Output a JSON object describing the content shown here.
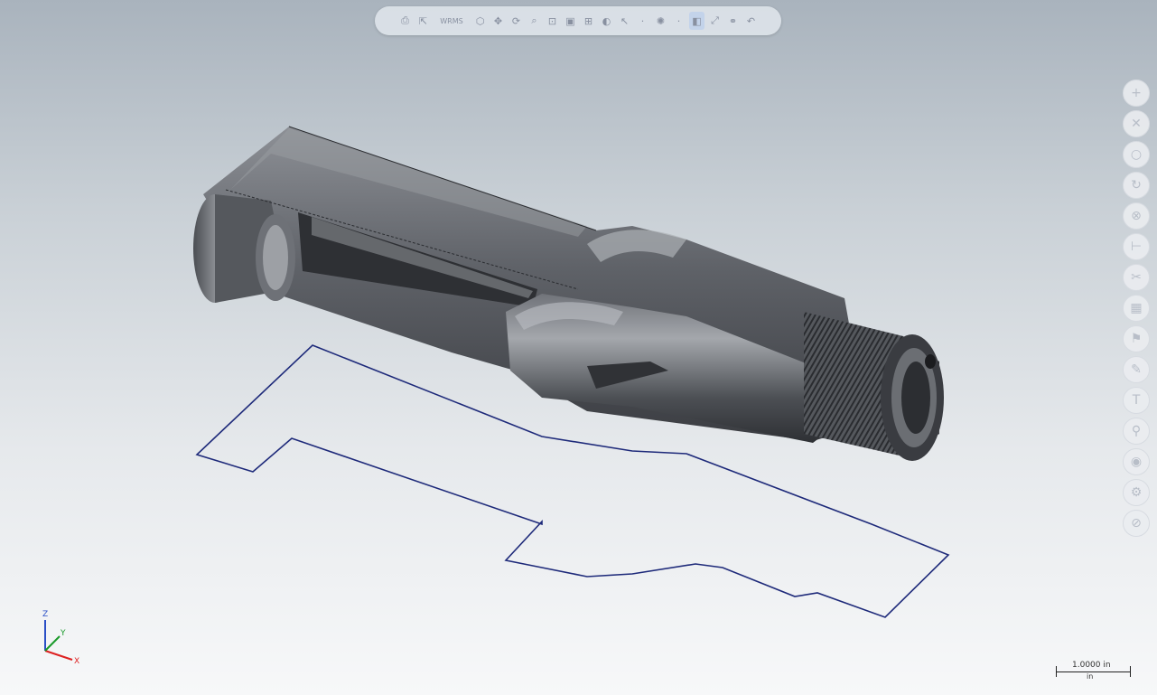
{
  "toolbar": {
    "buttons": [
      {
        "name": "save-view-icon",
        "glyph": "⎙"
      },
      {
        "name": "select-icon",
        "glyph": "⇱"
      },
      {
        "name": "view-label",
        "label": "WRMS"
      },
      {
        "name": "isometric-icon",
        "glyph": "⬡"
      },
      {
        "name": "pan-icon",
        "glyph": "✥"
      },
      {
        "name": "rotate-icon",
        "glyph": "⟳"
      },
      {
        "name": "zoom-icon",
        "glyph": "⌕"
      },
      {
        "name": "fit-icon",
        "glyph": "⊡"
      },
      {
        "name": "section-icon",
        "glyph": "▣"
      },
      {
        "name": "measure-icon",
        "glyph": "⊞"
      },
      {
        "name": "render-icon",
        "glyph": "◐"
      },
      {
        "name": "pointer-icon",
        "glyph": "↖"
      },
      {
        "name": "dot-icon",
        "glyph": "·"
      },
      {
        "name": "light-icon",
        "glyph": "✺"
      },
      {
        "name": "dot2-icon",
        "glyph": "·"
      },
      {
        "name": "cube-icon",
        "glyph": "◧"
      },
      {
        "name": "snap-icon",
        "glyph": "⤢"
      },
      {
        "name": "link-icon",
        "glyph": "⚭"
      },
      {
        "name": "undo-icon",
        "glyph": "↶"
      }
    ]
  },
  "side_toolbar": [
    {
      "name": "add-icon",
      "glyph": "+"
    },
    {
      "name": "close-icon",
      "glyph": "✕"
    },
    {
      "name": "circle-icon",
      "glyph": "○"
    },
    {
      "name": "arc-icon",
      "glyph": "↻"
    },
    {
      "name": "mate-icon",
      "glyph": "⊗"
    },
    {
      "name": "dimension-icon",
      "glyph": "⊢"
    },
    {
      "name": "trim-icon",
      "glyph": "✂"
    },
    {
      "name": "texture-icon",
      "glyph": "▦"
    },
    {
      "name": "flag-icon",
      "glyph": "⚑"
    },
    {
      "name": "paint-icon",
      "glyph": "✎"
    },
    {
      "name": "text-icon",
      "glyph": "T"
    },
    {
      "name": "pin-icon",
      "glyph": "⚲"
    },
    {
      "name": "globe-icon",
      "glyph": "◉"
    },
    {
      "name": "settings-icon",
      "glyph": "⚙"
    },
    {
      "name": "stop-icon",
      "glyph": "⊘"
    }
  ],
  "triad": {
    "x": "X",
    "y": "Y",
    "z": "Z"
  },
  "scale": {
    "value": "1.0000 in",
    "unit": "in"
  }
}
